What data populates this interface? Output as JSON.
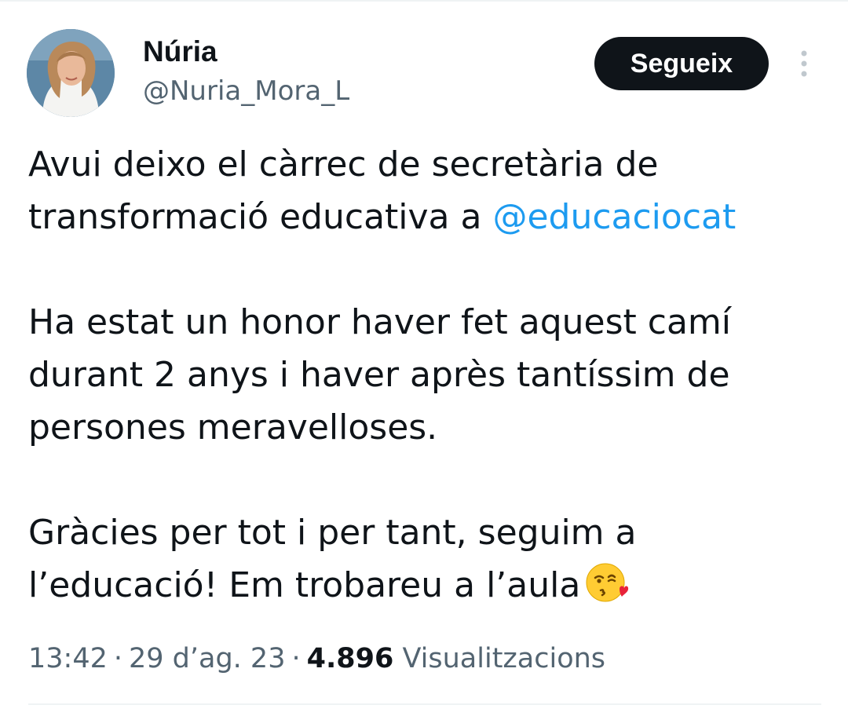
{
  "author": {
    "display_name": "Núria",
    "handle": "@Nuria_Mora_L"
  },
  "follow_button": {
    "label": "Segueix"
  },
  "tweet": {
    "line1": "Avui deixo el càrrec de secretària de",
    "line2_prefix": "transformació educativa a ",
    "mention": "@educaciocat",
    "line3": "Ha estat un honor haver fet aquest camí",
    "line4": "durant 2 anys i haver après tantíssim de",
    "line5": "persones meravelloses.",
    "line6": "Gràcies per tot i per tant, seguim a",
    "line7": "l’educació! Em trobareu a l’aula"
  },
  "meta": {
    "time": "13:42",
    "date": "29 d’ag. 23",
    "separator": "·",
    "views_count": "4.896",
    "views_label": "Visualitzacions"
  },
  "colors": {
    "link": "#1d9bf0",
    "secondary_text": "#536471",
    "primary_text": "#0f1419",
    "button_bg": "#0f1419"
  },
  "icons": {
    "more": "more-vertical-icon",
    "emoji": "kissing-face-emoji"
  }
}
